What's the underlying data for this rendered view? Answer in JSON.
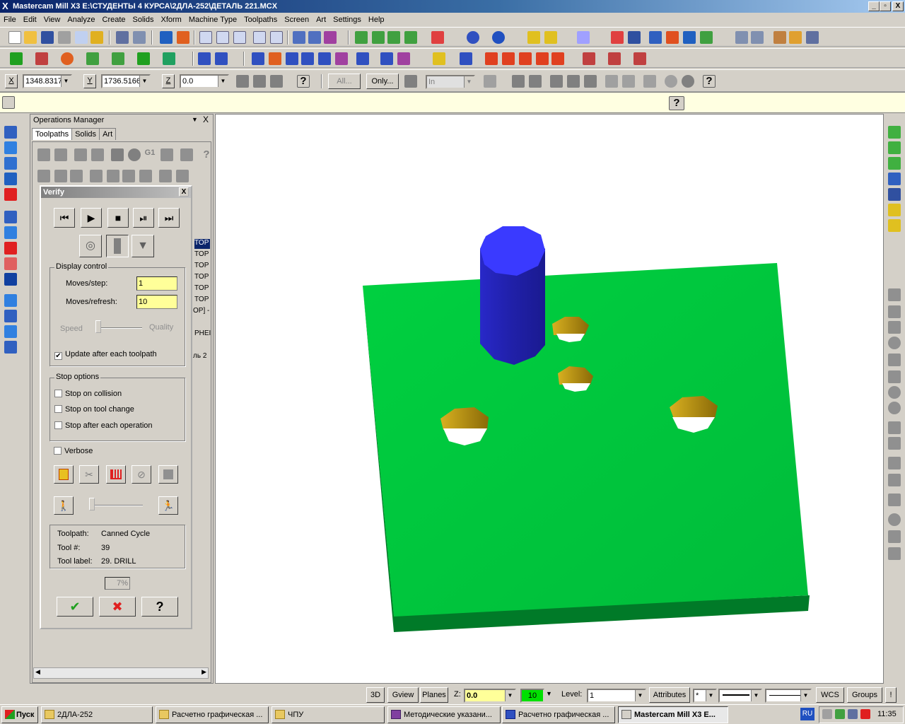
{
  "window": {
    "title": "Mastercam Mill X3  E:\\СТУДЕНТЫ 4 КУРСА\\2ДЛА-252\\ДЕТАЛЬ 221.MCX",
    "minimize": "_",
    "restore": "▫",
    "close": "X"
  },
  "menu": [
    "File",
    "Edit",
    "View",
    "Analyze",
    "Create",
    "Solids",
    "Xform",
    "Machine Type",
    "Toolpaths",
    "Screen",
    "Art",
    "Settings",
    "Help"
  ],
  "coords": {
    "x_label": "X",
    "x_value": "1348.8317",
    "y_label": "Y",
    "y_value": "1736.5166",
    "z_label": "Z",
    "z_value": "0.0",
    "all_button": "All...",
    "only_button": "Only...",
    "units_combo": "In"
  },
  "help_glyph": "?",
  "ops_manager": {
    "title": "Operations Manager",
    "close": "X",
    "tabs": [
      "Toolpaths",
      "Solids",
      "Art"
    ],
    "list_fragments": [
      "TOP",
      "TOP",
      "TOP",
      "TOP",
      "TOP",
      "TOP",
      "OP] -",
      "PHEI",
      "ль 2"
    ]
  },
  "verify": {
    "title": "Verify",
    "close": "X",
    "display_control": {
      "label": "Display control",
      "moves_step_label": "Moves/step:",
      "moves_step_value": "1",
      "moves_refresh_label": "Moves/refresh:",
      "moves_refresh_value": "10",
      "speed_label": "Speed",
      "quality_label": "Quality",
      "update_label": "Update after each toolpath",
      "update_checked": true
    },
    "stop_options": {
      "label": "Stop options",
      "items": [
        {
          "label": "Stop on collision",
          "checked": false
        },
        {
          "label": "Stop on tool change",
          "checked": false
        },
        {
          "label": "Stop after each operation",
          "checked": false
        }
      ]
    },
    "verbose": {
      "label": "Verbose",
      "checked": false
    },
    "info": {
      "toolpath_label": "Toolpath:",
      "toolpath_value": "Canned Cycle",
      "tool_num_label": "Tool #:",
      "tool_num_value": "39",
      "tool_label_label": "Tool label:",
      "tool_label_value": "29. DRILL"
    },
    "progress": "7%",
    "ok": "✔",
    "cancel": "✖",
    "help": "?"
  },
  "statusbar": {
    "view3d": "3D",
    "gview": "Gview",
    "planes": "Planes",
    "z_label": "Z:",
    "z_value": "0.0",
    "color_value": "10",
    "level_label": "Level:",
    "level_value": "1",
    "attributes": "Attributes",
    "point_style": "*",
    "wcs": "WCS",
    "groups": "Groups",
    "bang": "!"
  },
  "taskbar": {
    "start": "Пуск",
    "tasks": [
      "2ДЛА-252",
      "Расчетно графическая ...",
      "ЧПУ",
      "Методические указани...",
      "Расчетно графическая ...",
      "Mastercam Mill X3  E..."
    ],
    "lang": "RU",
    "time": "11:35"
  },
  "colors": {
    "plate": "#00c840",
    "plate_side": "#007a28",
    "boss_top": "#3a3aff",
    "boss_side": "#1c1cb0",
    "hole": "#c09a10"
  }
}
